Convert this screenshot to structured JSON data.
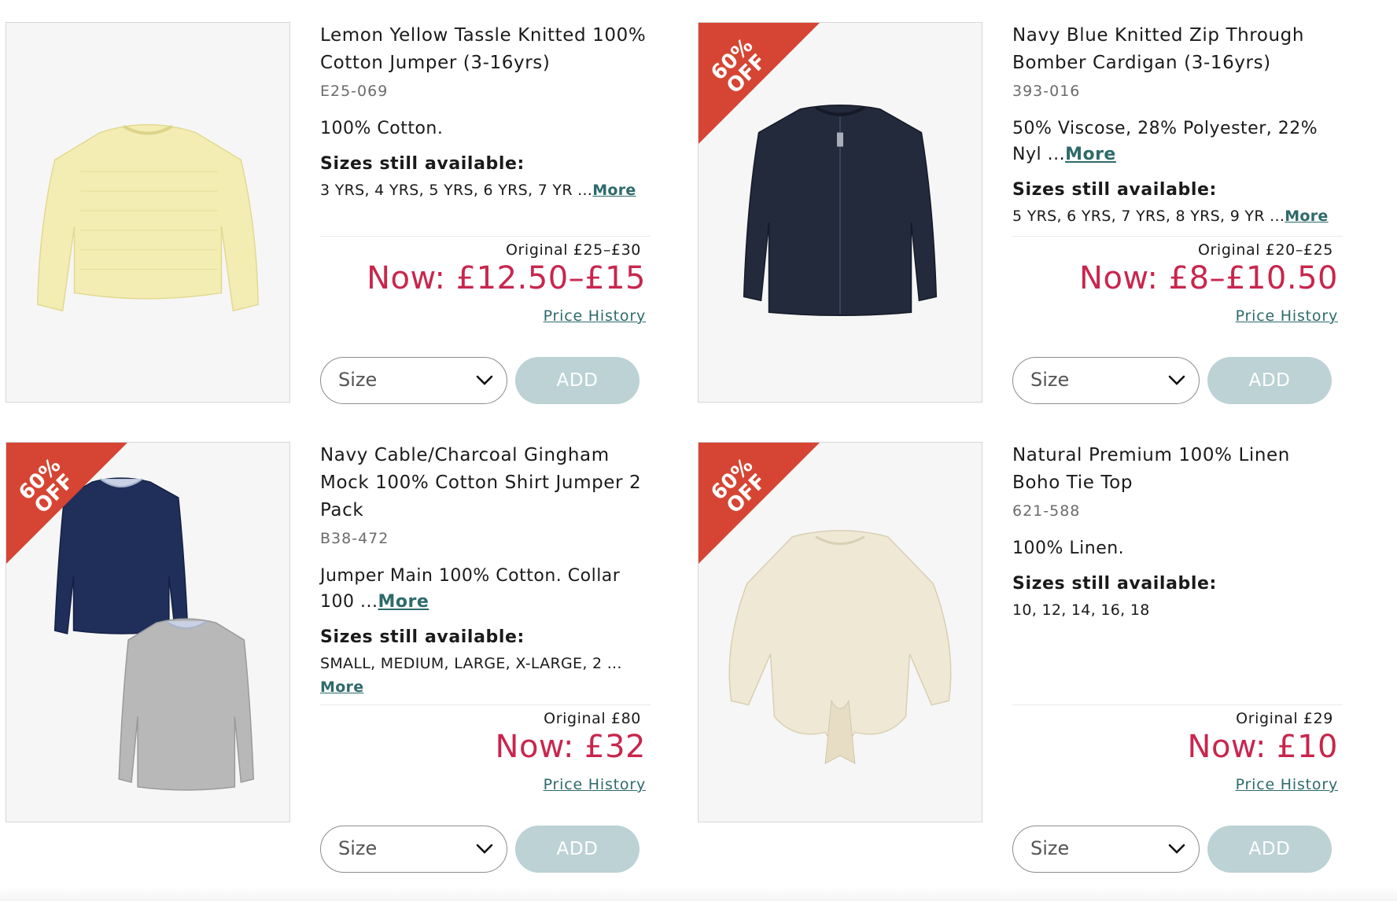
{
  "products": [
    {
      "title": "Lemon Yellow Tassle Knitted 100% Cotton Jumper (3-16yrs)",
      "code": "E25-069",
      "description": "100% Cotton.",
      "description_more": "",
      "sizes_heading": "Sizes still available:",
      "sizes": "3 YRS, 4 YRS, 5 YRS, 6 YRS, 7 YR ...",
      "sizes_more": "More",
      "badge": "",
      "original_price": "Original £25–£30",
      "now_price": "Now: £12.50–£15",
      "price_history": "Price History",
      "size_placeholder": "Size",
      "add_label": "ADD",
      "image": "yellow-knitted-jumper"
    },
    {
      "title": "Navy Blue Knitted Zip Through Bomber Cardigan (3-16yrs)",
      "code": "393-016",
      "description": "50% Viscose, 28% Polyester, 22% Nyl ...",
      "description_more": "More",
      "sizes_heading": "Sizes still available:",
      "sizes": "5 YRS, 6 YRS, 7 YRS, 8 YRS, 9 YR ...",
      "sizes_more": "More",
      "badge": "60% OFF",
      "original_price": "Original £20–£25",
      "now_price": "Now: £8–£10.50",
      "price_history": "Price History",
      "size_placeholder": "Size",
      "add_label": "ADD",
      "image": "navy-zip-cardigan"
    },
    {
      "title": "Navy Cable/Charcoal Gingham Mock 100% Cotton Shirt Jumper 2 Pack",
      "code": "B38-472",
      "description": "Jumper Main 100% Cotton. Collar 100 ...",
      "description_more": "More",
      "sizes_heading": "Sizes still available:",
      "sizes": "SMALL, MEDIUM, LARGE, X-LARGE, 2 ...",
      "sizes_more": "More",
      "badge": "60% OFF",
      "original_price": "Original £80",
      "now_price": "Now: £32",
      "price_history": "Price History",
      "size_placeholder": "Size",
      "add_label": "ADD",
      "image": "navy-grey-jumper-pack"
    },
    {
      "title": "Natural Premium 100% Linen Boho Tie Top",
      "code": "621-588",
      "description": "100% Linen.",
      "description_more": "",
      "sizes_heading": "Sizes still available:",
      "sizes": "10, 12, 14, 16, 18",
      "sizes_more": "",
      "badge": "60% OFF",
      "original_price": "Original £29",
      "now_price": "Now: £10",
      "price_history": "Price History",
      "size_placeholder": "Size",
      "add_label": "ADD",
      "image": "linen-tie-top"
    }
  ],
  "colors": {
    "badge": "#d64533",
    "now_price": "#c8264d",
    "link": "#2e6a6b",
    "add_button": "#bcd2d4"
  }
}
